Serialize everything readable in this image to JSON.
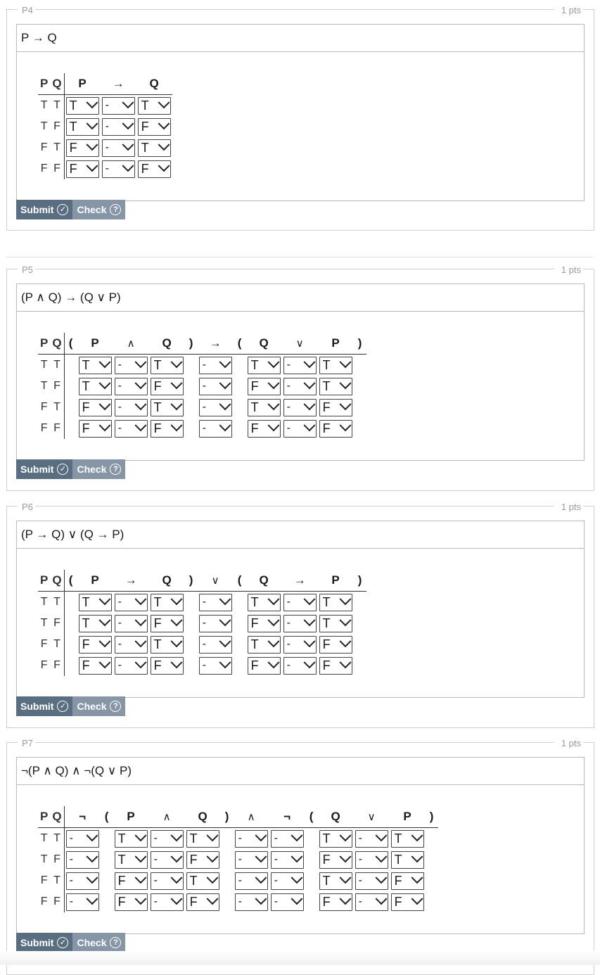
{
  "problems": [
    {
      "id": "P4",
      "points": "1 pts",
      "formula": "P → Q",
      "header": [
        "P",
        "Q",
        "P",
        "→",
        "Q"
      ],
      "rows": [
        {
          "vars": [
            "T",
            "T"
          ],
          "cells": [
            "T",
            "-",
            "T"
          ]
        },
        {
          "vars": [
            "T",
            "F"
          ],
          "cells": [
            "T",
            "-",
            "F"
          ]
        },
        {
          "vars": [
            "F",
            "T"
          ],
          "cells": [
            "F",
            "-",
            "T"
          ]
        },
        {
          "vars": [
            "F",
            "F"
          ],
          "cells": [
            "F",
            "-",
            "F"
          ]
        }
      ],
      "submit_label": "Submit",
      "check_label": "Check"
    },
    {
      "id": "P5",
      "points": "1 pts",
      "formula": "(P ∧ Q) → (Q ∨ P)",
      "header": [
        "P",
        "Q",
        "(",
        "P",
        "∧",
        "Q",
        ")",
        "→",
        "(",
        "Q",
        "∨",
        "P",
        ")"
      ],
      "rows": [
        {
          "vars": [
            "T",
            "T"
          ],
          "cells": [
            "T",
            "-",
            "T",
            "-",
            "T",
            "-",
            "T"
          ]
        },
        {
          "vars": [
            "T",
            "F"
          ],
          "cells": [
            "T",
            "-",
            "F",
            "-",
            "F",
            "-",
            "T"
          ]
        },
        {
          "vars": [
            "F",
            "T"
          ],
          "cells": [
            "F",
            "-",
            "T",
            "-",
            "T",
            "-",
            "F"
          ]
        },
        {
          "vars": [
            "F",
            "F"
          ],
          "cells": [
            "F",
            "-",
            "F",
            "-",
            "F",
            "-",
            "F"
          ]
        }
      ],
      "submit_label": "Submit",
      "check_label": "Check"
    },
    {
      "id": "P6",
      "points": "1 pts",
      "formula": "(P → Q) ∨ (Q → P)",
      "header": [
        "P",
        "Q",
        "(",
        "P",
        "→",
        "Q",
        ")",
        "∨",
        "(",
        "Q",
        "→",
        "P",
        ")"
      ],
      "rows": [
        {
          "vars": [
            "T",
            "T"
          ],
          "cells": [
            "T",
            "-",
            "T",
            "-",
            "T",
            "-",
            "T"
          ]
        },
        {
          "vars": [
            "T",
            "F"
          ],
          "cells": [
            "T",
            "-",
            "F",
            "-",
            "F",
            "-",
            "T"
          ]
        },
        {
          "vars": [
            "F",
            "T"
          ],
          "cells": [
            "F",
            "-",
            "T",
            "-",
            "T",
            "-",
            "F"
          ]
        },
        {
          "vars": [
            "F",
            "F"
          ],
          "cells": [
            "F",
            "-",
            "F",
            "-",
            "F",
            "-",
            "F"
          ]
        }
      ],
      "submit_label": "Submit",
      "check_label": "Check"
    },
    {
      "id": "P7",
      "points": "1 pts",
      "formula": "¬(P ∧ Q) ∧ ¬(Q ∨ P)",
      "header": [
        "P",
        "Q",
        "¬",
        "(",
        "P",
        "∧",
        "Q",
        ")",
        "∧",
        "¬",
        "(",
        "Q",
        "∨",
        "P",
        ")"
      ],
      "rows": [
        {
          "vars": [
            "T",
            "T"
          ],
          "cells": [
            "-",
            "T",
            "-",
            "T",
            "-",
            "-",
            "T",
            "-",
            "T"
          ]
        },
        {
          "vars": [
            "T",
            "F"
          ],
          "cells": [
            "-",
            "T",
            "-",
            "F",
            "-",
            "-",
            "F",
            "-",
            "T"
          ]
        },
        {
          "vars": [
            "F",
            "T"
          ],
          "cells": [
            "-",
            "F",
            "-",
            "T",
            "-",
            "-",
            "T",
            "-",
            "F"
          ]
        },
        {
          "vars": [
            "F",
            "F"
          ],
          "cells": [
            "-",
            "F",
            "-",
            "F",
            "-",
            "-",
            "F",
            "-",
            "F"
          ]
        }
      ],
      "submit_label": "Submit",
      "check_label": "Check"
    }
  ],
  "colors": {
    "submit": "#5a6e82",
    "check": "#8796a6",
    "border": "#b9b9b9"
  }
}
